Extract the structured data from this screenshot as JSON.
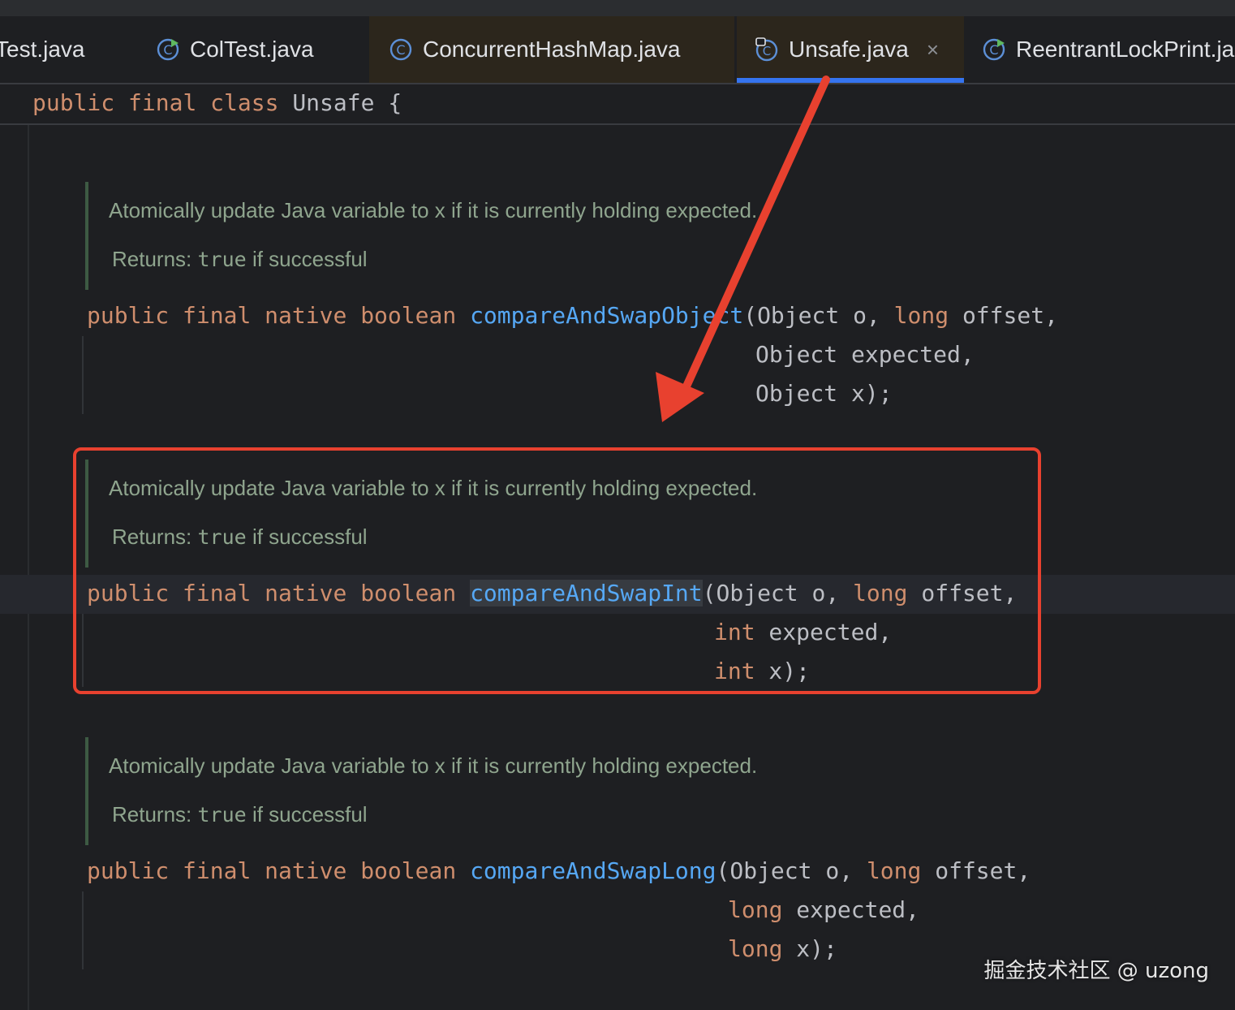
{
  "tabs": [
    {
      "label": "Test.java",
      "icon": "run-class-icon",
      "active": false
    },
    {
      "label": "ColTest.java",
      "icon": "run-class-icon",
      "active": false
    },
    {
      "label": "ConcurrentHashMap.java",
      "icon": "class-icon",
      "active": false
    },
    {
      "label": "Unsafe.java",
      "icon": "locked-class-icon",
      "active": true,
      "close": "×"
    },
    {
      "label": "ReentrantLockPrint.ja",
      "icon": "run-class-icon",
      "active": false
    }
  ],
  "header": {
    "kw_public": "public",
    "kw_final": "final",
    "kw_class": "class",
    "name": "Unsafe",
    "brace": "{"
  },
  "methods": [
    {
      "doc": "Atomically update Java variable to x if it is currently holding expected.",
      "returns_label": "Returns:",
      "returns_true": "true",
      "returns_rest": "if successful",
      "mods": [
        "public",
        "final",
        "native",
        "boolean"
      ],
      "name": "compareAndSwapObject",
      "line1_rest": "(Object o, ",
      "line1_type": "long",
      "line1_tail": " offset,",
      "line2": "Object expected,",
      "line3": "Object x);"
    },
    {
      "doc": "Atomically update Java variable to x if it is currently holding expected.",
      "returns_label": "Returns:",
      "returns_true": "true",
      "returns_rest": "if successful",
      "mods": [
        "public",
        "final",
        "native",
        "boolean"
      ],
      "name": "compareAndSwapInt",
      "line1_rest": "(Object o, ",
      "line1_type": "long",
      "line1_tail": " offset,",
      "line2_type": "int",
      "line2_tail": " expected,",
      "line3_type": "int",
      "line3_tail": " x);"
    },
    {
      "doc": "Atomically update Java variable to x if it is currently holding expected.",
      "returns_label": "Returns:",
      "returns_true": "true",
      "returns_rest": "if successful",
      "mods": [
        "public",
        "final",
        "native",
        "boolean"
      ],
      "name": "compareAndSwapLong",
      "line1_rest": "(Object o, ",
      "line1_type": "long",
      "line1_tail": " offset,",
      "line2_type": "long",
      "line2_tail": " expected,",
      "line3_type": "long",
      "line3_tail": " x);"
    }
  ],
  "watermark": "掘金技术社区 @ uzong",
  "colors": {
    "keyword": "#cf8e6d",
    "function": "#56a8f5",
    "doc": "#8fa58e",
    "annotation_red": "#e8412f",
    "tab_accent": "#3574f0"
  }
}
